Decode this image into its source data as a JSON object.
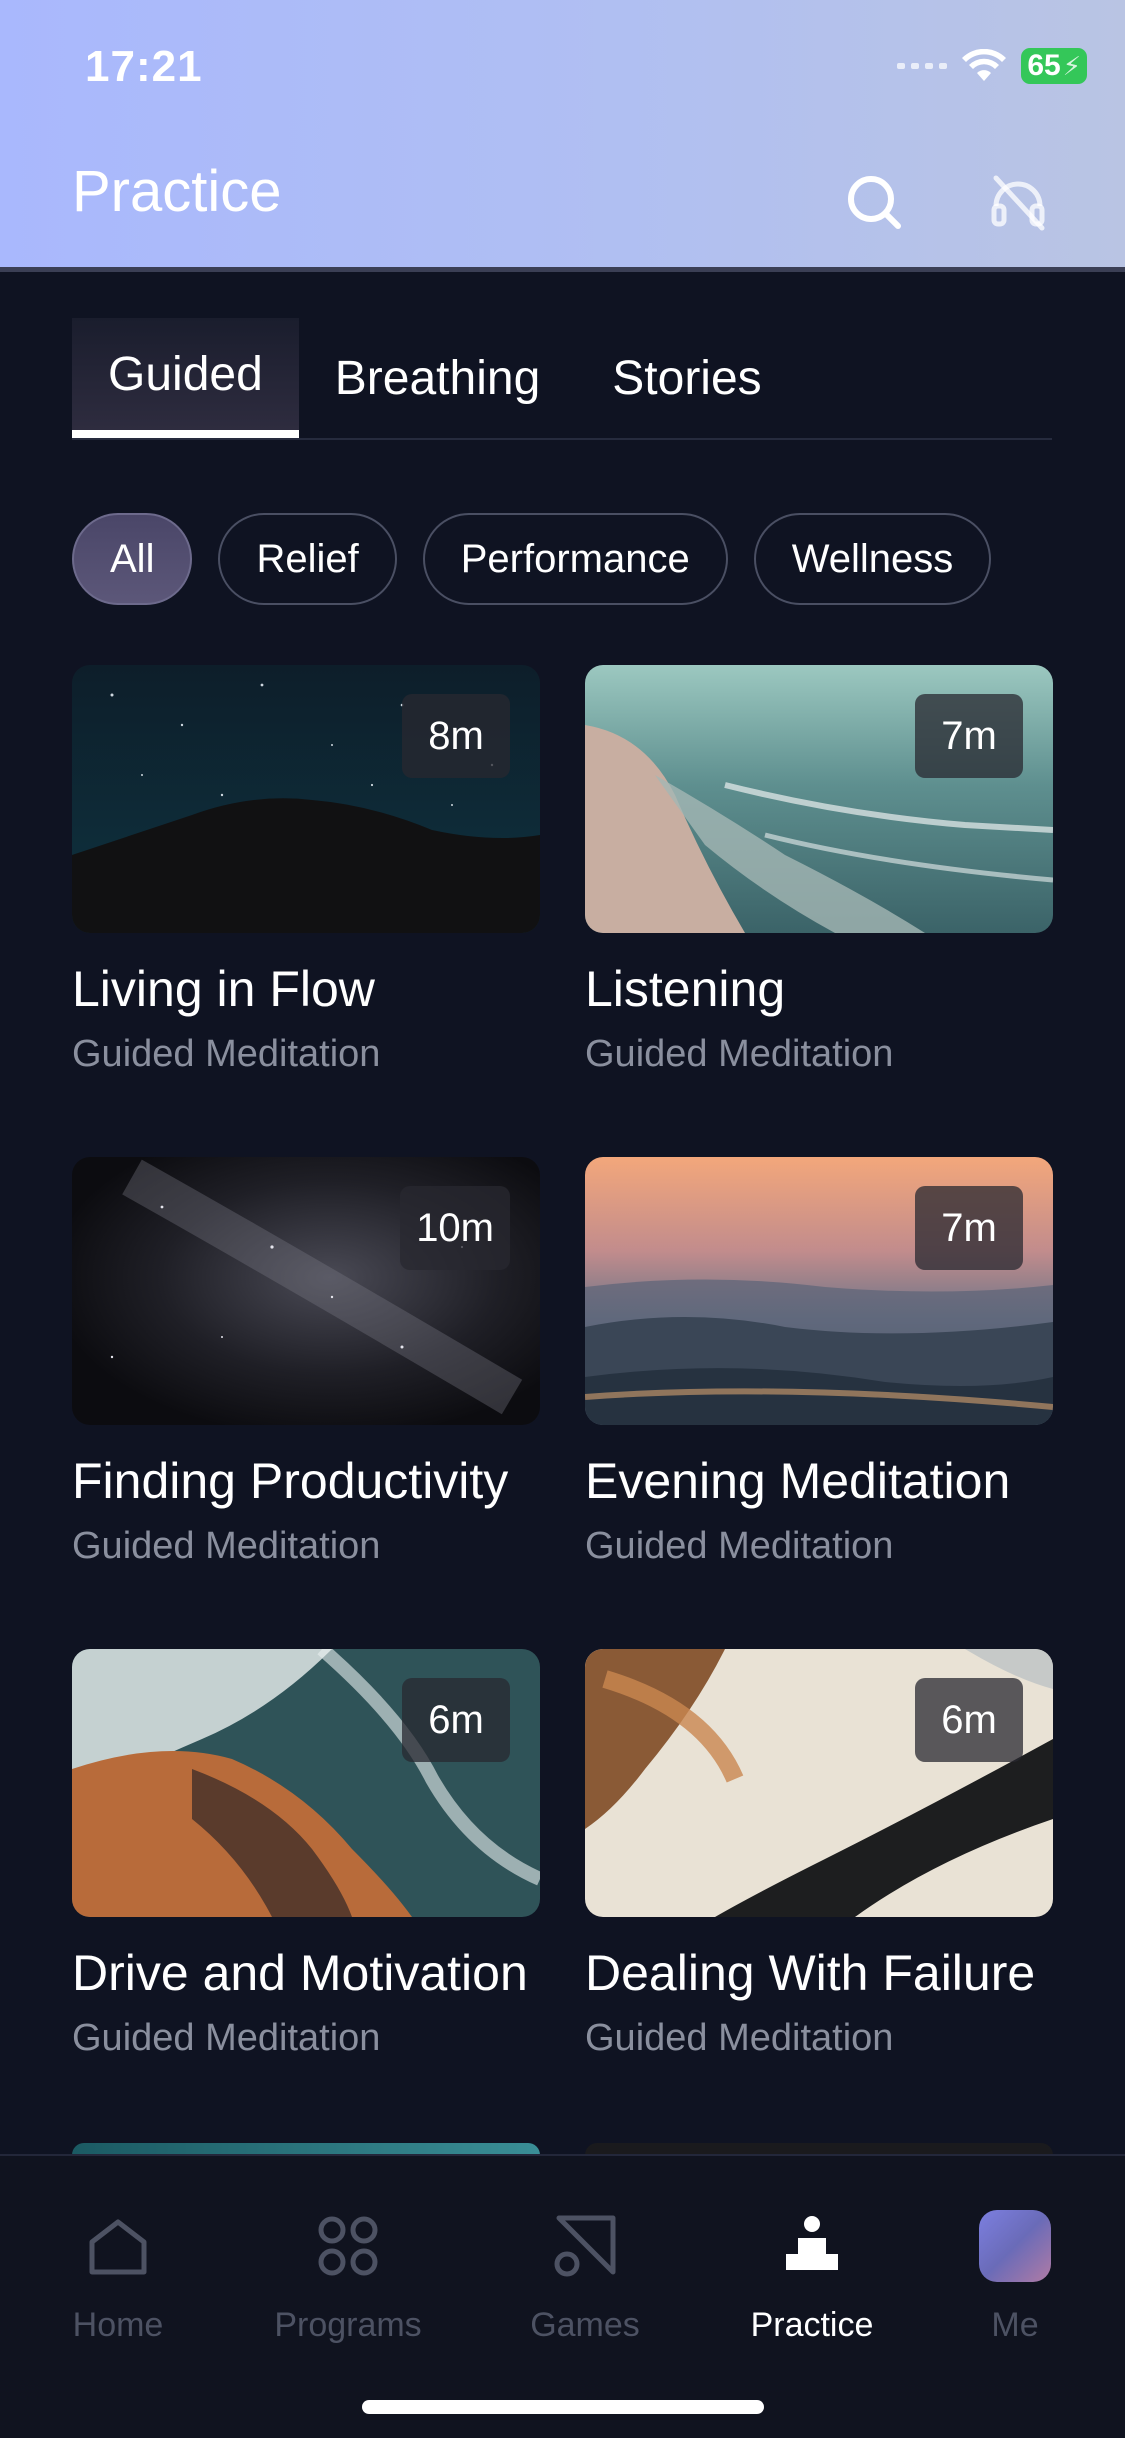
{
  "status": {
    "time": "17:21",
    "battery": "65"
  },
  "header": {
    "title": "Practice",
    "icons": [
      "search-icon",
      "no-sound-icon"
    ]
  },
  "tabs": [
    {
      "label": "Guided",
      "active": true
    },
    {
      "label": "Breathing",
      "active": false
    },
    {
      "label": "Stories",
      "active": false
    }
  ],
  "filters": [
    {
      "label": "All",
      "active": true
    },
    {
      "label": "Relief",
      "active": false
    },
    {
      "label": "Performance",
      "active": false
    },
    {
      "label": "Wellness",
      "active": false
    }
  ],
  "sessions": [
    {
      "title": "Living in Flow",
      "subtitle": "Guided Meditation",
      "duration": "8m",
      "image": "night-hills"
    },
    {
      "title": "Listening",
      "subtitle": "Guided Meditation",
      "duration": "7m",
      "image": "beach-waves"
    },
    {
      "title": "Finding Productivity",
      "subtitle": "Guided Meditation",
      "duration": "10m",
      "image": "milky-way"
    },
    {
      "title": "Evening Meditation",
      "subtitle": "Guided Meditation",
      "duration": "7m",
      "image": "sunset-mountains"
    },
    {
      "title": "Drive and Motivation",
      "subtitle": "Guided Meditation",
      "duration": "6m",
      "image": "aerial-coast"
    },
    {
      "title": "Dealing With Failure",
      "subtitle": "Guided Meditation",
      "duration": "6m",
      "image": "aerial-river"
    }
  ],
  "nav": [
    {
      "label": "Home",
      "icon": "home-icon",
      "active": false
    },
    {
      "label": "Programs",
      "icon": "programs-icon",
      "active": false
    },
    {
      "label": "Games",
      "icon": "games-icon",
      "active": false
    },
    {
      "label": "Practice",
      "icon": "practice-icon",
      "active": true
    },
    {
      "label": "Me",
      "icon": "avatar",
      "active": false
    }
  ],
  "colors": {
    "header_start": "#a9b8fd",
    "background": "#0f1322",
    "accent": "#ffffff",
    "battery": "#34c759"
  }
}
